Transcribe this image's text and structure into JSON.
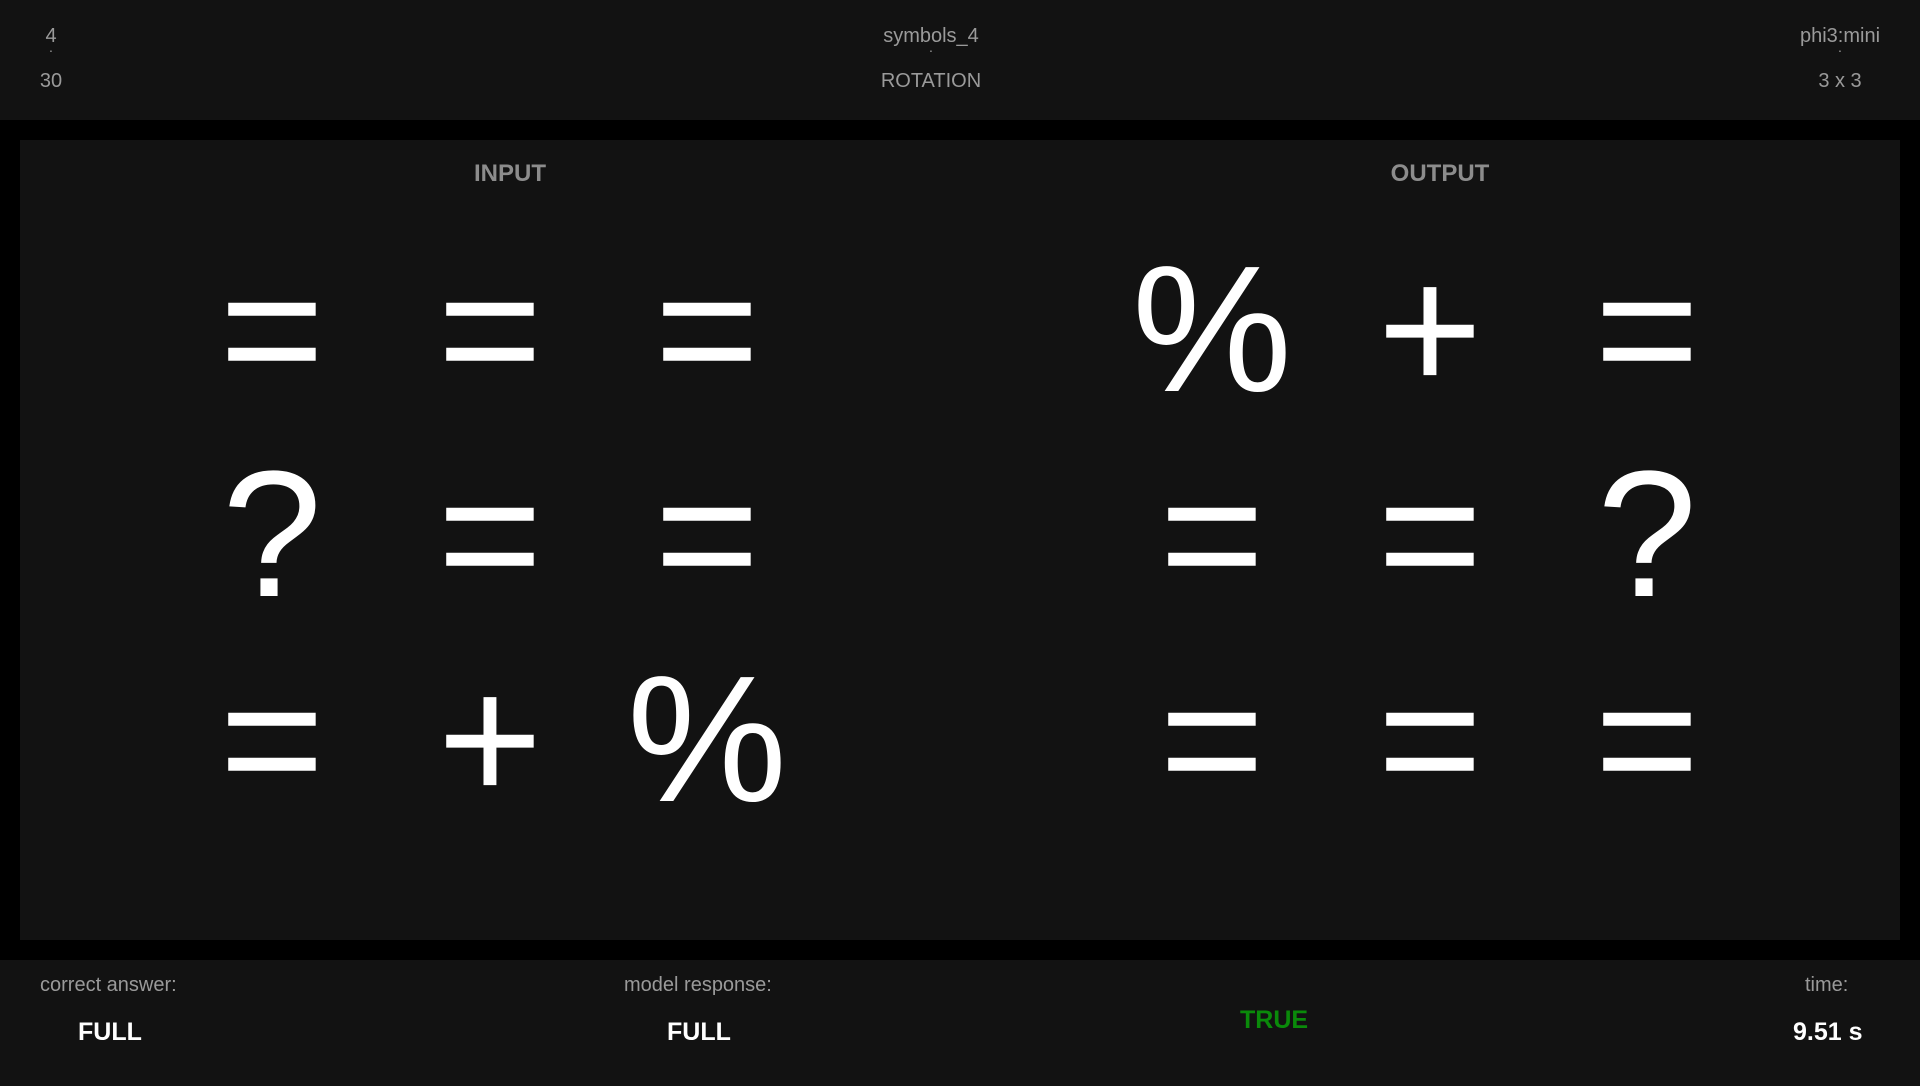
{
  "header": {
    "left": {
      "top": "4",
      "bottom": "30"
    },
    "center": {
      "top": "symbols_4",
      "bottom": "ROTATION"
    },
    "right": {
      "top": "phi3:mini",
      "bottom": "3 x 3"
    },
    "separator": "·"
  },
  "input": {
    "title": "INPUT",
    "rows": [
      [
        "=",
        "=",
        "="
      ],
      [
        "?",
        "=",
        "="
      ],
      [
        "=",
        "+",
        "%"
      ]
    ]
  },
  "output": {
    "title": "OUTPUT",
    "rows": [
      [
        "%",
        "+",
        "="
      ],
      [
        "=",
        "=",
        "?"
      ],
      [
        "=",
        "=",
        "="
      ]
    ]
  },
  "footer": {
    "correct_answer_label": "correct answer:",
    "correct_answer_value": "FULL",
    "model_response_label": "model response:",
    "model_response_value": "FULL",
    "verdict": "TRUE",
    "verdict_color": "#0a8a0a",
    "time_label": "time:",
    "time_value": "9.51 s"
  },
  "colors": {
    "background": "#000000",
    "panel": "#121212",
    "muted_text": "#9a9a9a",
    "symbol": "#ffffff"
  }
}
